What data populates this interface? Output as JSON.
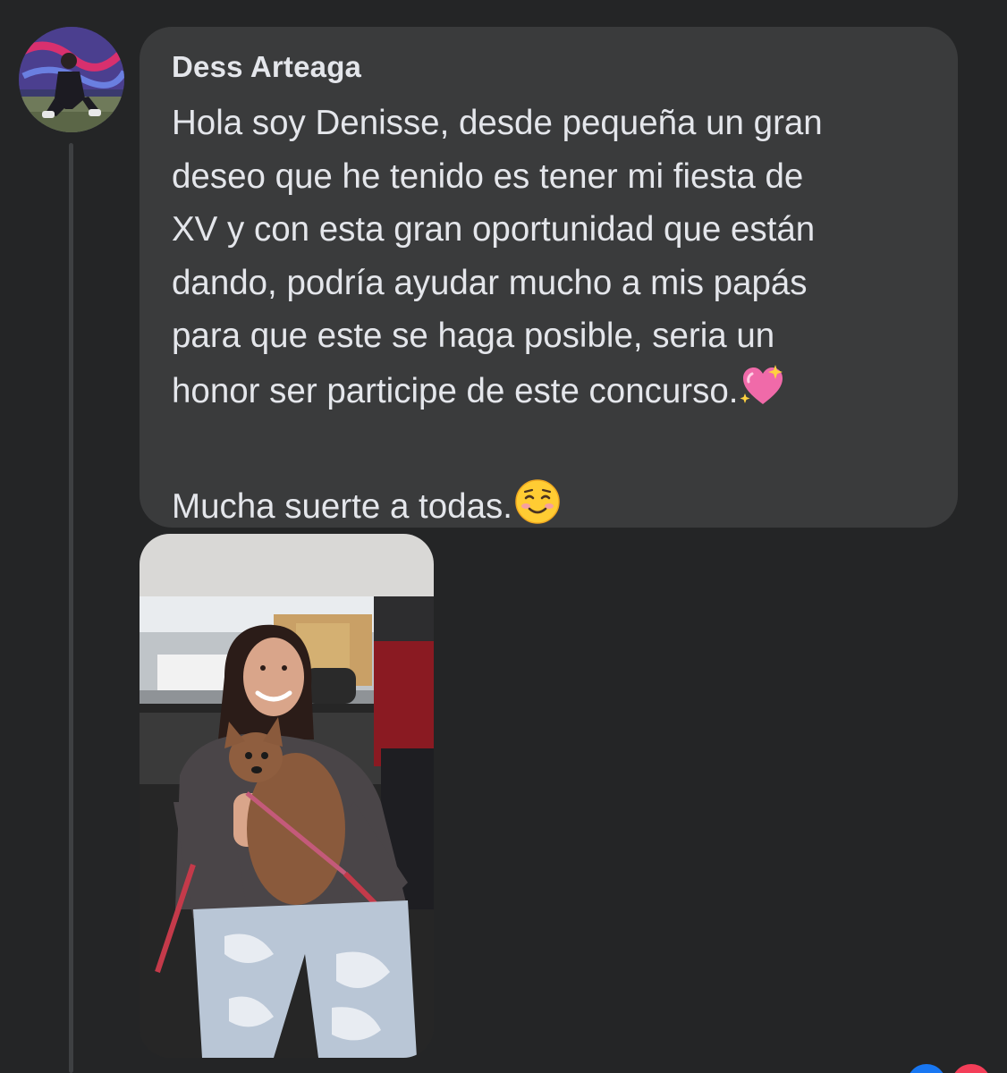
{
  "comment": {
    "author": "Dess Arteaga",
    "lines": [
      "Hola soy Denisse, desde pequeña un gran",
      "deseo que he tenido es tener mi fiesta de",
      "XV y con esta gran oportunidad que están",
      "dando, podría ayudar mucho a mis papás",
      "para que este se haga posible, seria un",
      "honor ser participe de este concurso."
    ],
    "closing": "Mucha suerte a todas.",
    "emojis": {
      "after_body": "sparkling-heart-icon",
      "after_closing": "smiling-face-icon"
    }
  },
  "colors": {
    "background": "#242526",
    "bubble": "#3a3b3c",
    "text": "#e4e6eb",
    "thread_line": "#3e4042",
    "like_reaction": "#1877f2",
    "love_reaction": "#f33e58"
  },
  "icons": {
    "avatar": "profile-photo",
    "attachment": "photo-girl-with-dog-in-car",
    "reactions": [
      "like-reaction-icon",
      "love-reaction-icon"
    ]
  }
}
